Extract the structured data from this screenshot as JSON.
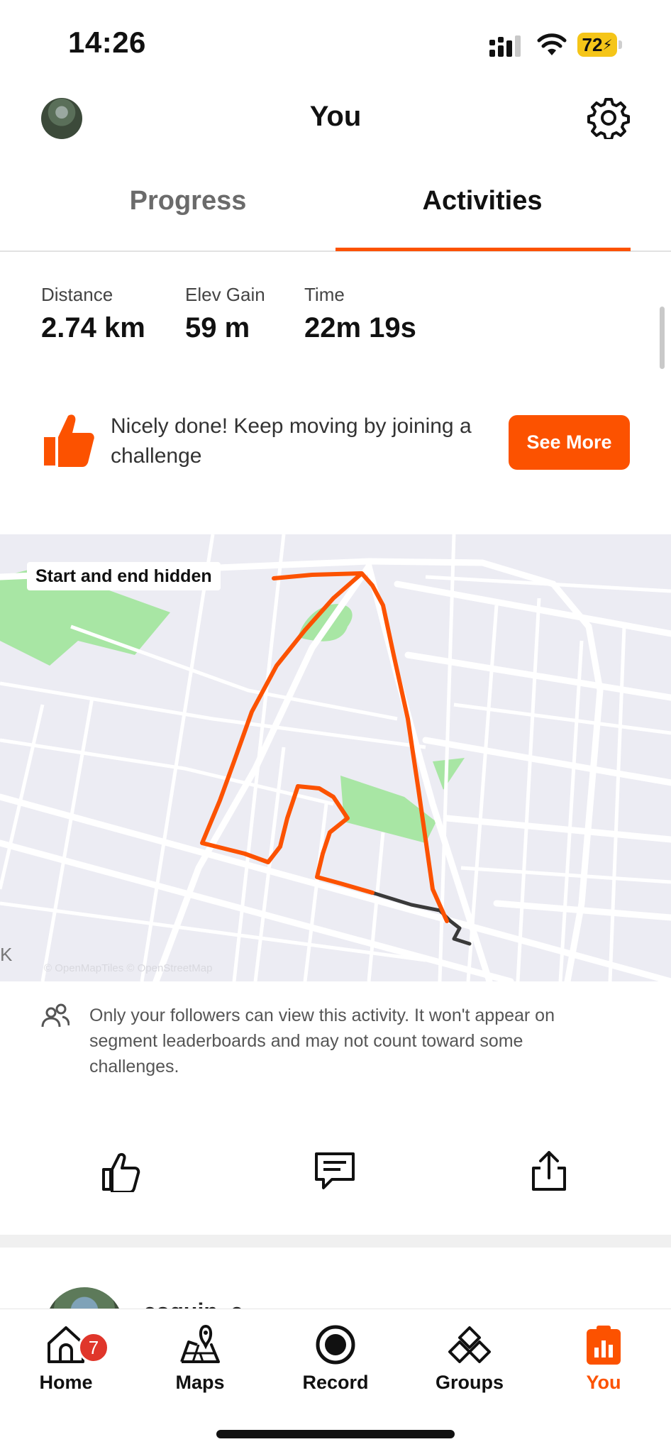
{
  "status_bar": {
    "time": "14:26",
    "battery": "72"
  },
  "header": {
    "title": "You"
  },
  "tabs": [
    {
      "label": "Progress",
      "active": false
    },
    {
      "label": "Activities",
      "active": true
    }
  ],
  "stats": [
    {
      "label": "Distance",
      "value": "2.74 km"
    },
    {
      "label": "Elev Gain",
      "value": "59 m"
    },
    {
      "label": "Time",
      "value": "22m 19s"
    }
  ],
  "challenge_banner": {
    "text": "Nicely done! Keep moving by joining a challenge",
    "button_label": "See More"
  },
  "map": {
    "privacy_badge": "Start and end hidden",
    "attribution": "© OpenMapTiles © OpenStreetMap",
    "edge_letter": "K"
  },
  "privacy_note": {
    "text": "Only your followers can view this activity. It won't appear on segment leaderboards and may not count toward some challenges."
  },
  "actions": {
    "icons": [
      "thumbs-up-icon",
      "comment-icon",
      "share-icon"
    ]
  },
  "next_post": {
    "name": "coquin_c"
  },
  "bottom_nav": [
    {
      "label": "Home",
      "icon": "home-icon",
      "badge": "7",
      "active": false
    },
    {
      "label": "Maps",
      "icon": "maps-icon",
      "active": false
    },
    {
      "label": "Record",
      "icon": "record-icon",
      "active": false
    },
    {
      "label": "Groups",
      "icon": "groups-icon",
      "active": false
    },
    {
      "label": "You",
      "icon": "you-icon",
      "active": true
    }
  ],
  "colors": {
    "accent": "#fc5200",
    "badge": "#e0362b",
    "battery": "#f5c518",
    "map_bg": "#ececf3",
    "park": "#a8e6a4"
  }
}
